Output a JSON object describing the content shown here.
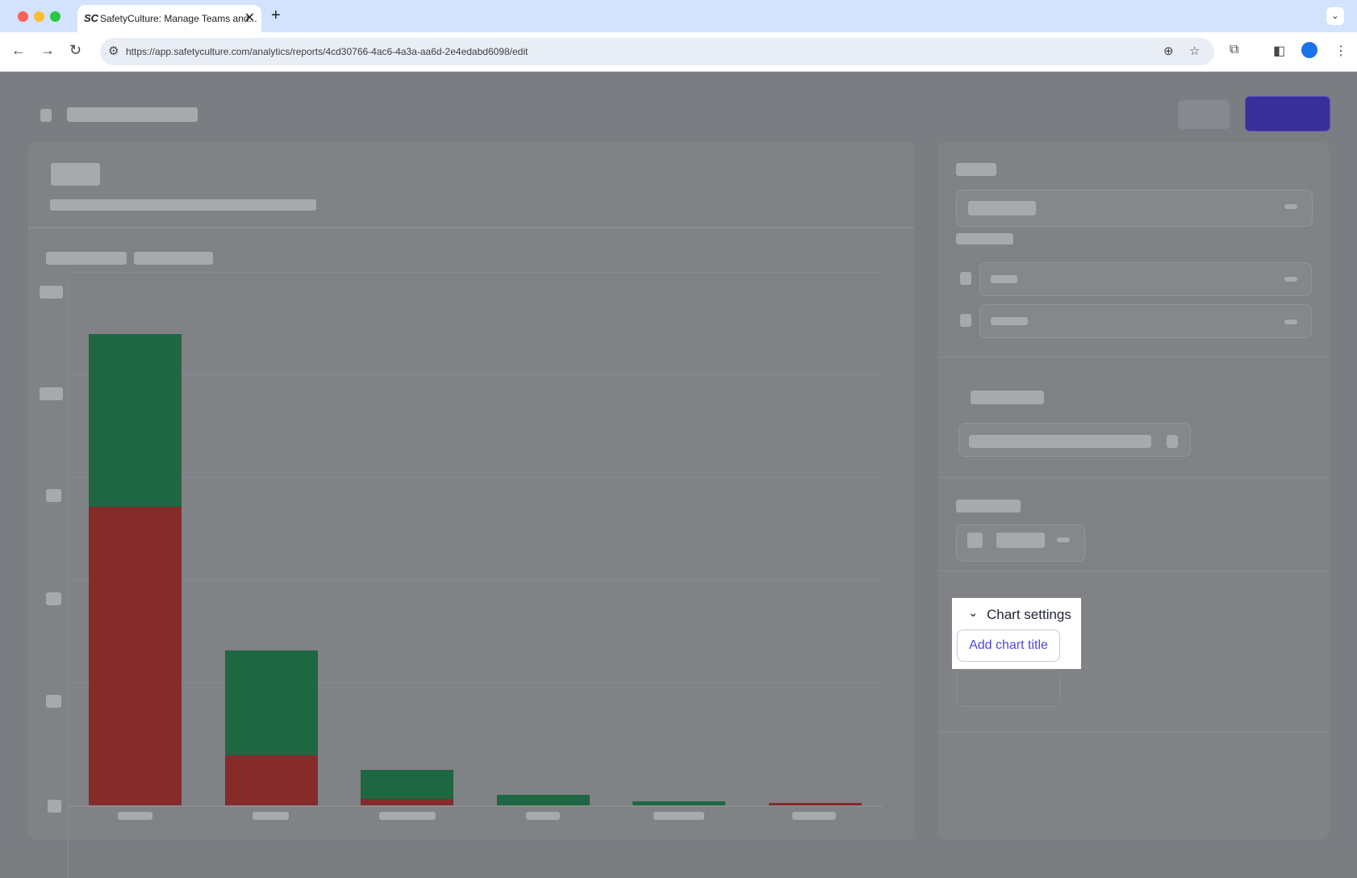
{
  "browser": {
    "tab_logo": "SC",
    "tab_title": "SafetyCulture: Manage Teams and...",
    "url": "https://app.safetyculture.com/analytics/reports/4cd30766-4ac6-4a3a-aa6d-2e4edabd6098/edit"
  },
  "chart_settings": {
    "title": "Chart settings",
    "add_title_button": "Add chart title"
  },
  "chart_data": {
    "type": "bar",
    "stacked": true,
    "categories": [
      "",
      "",
      "",
      "",
      "",
      ""
    ],
    "series": [
      {
        "color": "#862b2a",
        "values": [
          280,
          47,
          6,
          0,
          0,
          2
        ]
      },
      {
        "color": "#1f6742",
        "values": [
          162,
          98,
          27,
          10,
          4,
          0
        ]
      }
    ],
    "ylim": [
      0,
      500
    ],
    "grid": true
  },
  "colors": {
    "accent": "#4f46d8",
    "overlay": "#7b7d82"
  }
}
